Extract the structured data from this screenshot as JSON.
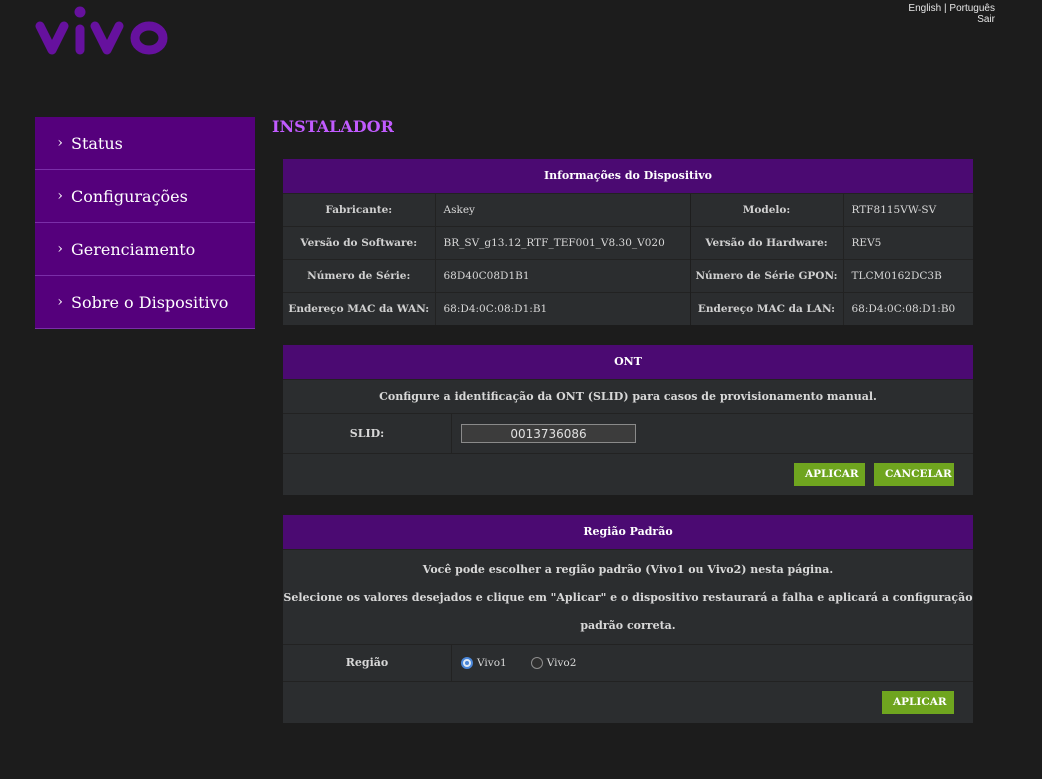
{
  "brand": {
    "logo_text": "vivo",
    "color": "#66119e"
  },
  "header": {
    "lang_english": "English",
    "lang_sep": "|",
    "lang_portuguese": "Português",
    "logout": "Sair"
  },
  "sidebar": {
    "items": [
      {
        "label": "Status"
      },
      {
        "label": "Configurações"
      },
      {
        "label": "Gerenciamento"
      },
      {
        "label": "Sobre o Dispositivo"
      }
    ]
  },
  "page": {
    "title": "INSTALADOR"
  },
  "device_info": {
    "title": "Informações do Dispositivo",
    "rows": [
      {
        "l1": "Fabricante:",
        "v1": "Askey",
        "l2": "Modelo:",
        "v2": "RTF8115VW-SV"
      },
      {
        "l1": "Versão do Software:",
        "v1": "BR_SV_g13.12_RTF_TEF001_V8.30_V020",
        "l2": "Versão do Hardware:",
        "v2": "REV5"
      },
      {
        "l1": "Número de Série:",
        "v1": "68D40C08D1B1",
        "l2": "Número de Série GPON:",
        "v2": "TLCM0162DC3B"
      },
      {
        "l1": "Endereço MAC da WAN:",
        "v1": "68:D4:0C:08:D1:B1",
        "l2": "Endereço MAC da LAN:",
        "v2": "68:D4:0C:08:D1:B0"
      }
    ]
  },
  "ont": {
    "title": "ONT",
    "description": "Configure a identificação da ONT (SLID) para casos de provisionamento manual.",
    "slid_label": "SLID:",
    "slid_value": "0013736086",
    "apply_label": "APLICAR",
    "cancel_label": "CANCELAR"
  },
  "region": {
    "title": "Região Padrão",
    "desc1": "Você pode escolher a região padrão (Vivo1 ou Vivo2) nesta página.",
    "desc2": "Selecione os valores desejados e clique em \"Aplicar\" e o dispositivo restaurará a falha e aplicará a configuração padrão correta.",
    "label": "Região",
    "option1": "Vivo1",
    "option2": "Vivo2",
    "selected": "Vivo1",
    "apply_label": "APLICAR"
  },
  "colors": {
    "accent_purple": "#55007c",
    "header_purple": "#4b0a72",
    "title_purple": "#c15bff",
    "button_green": "#6fa51f"
  }
}
